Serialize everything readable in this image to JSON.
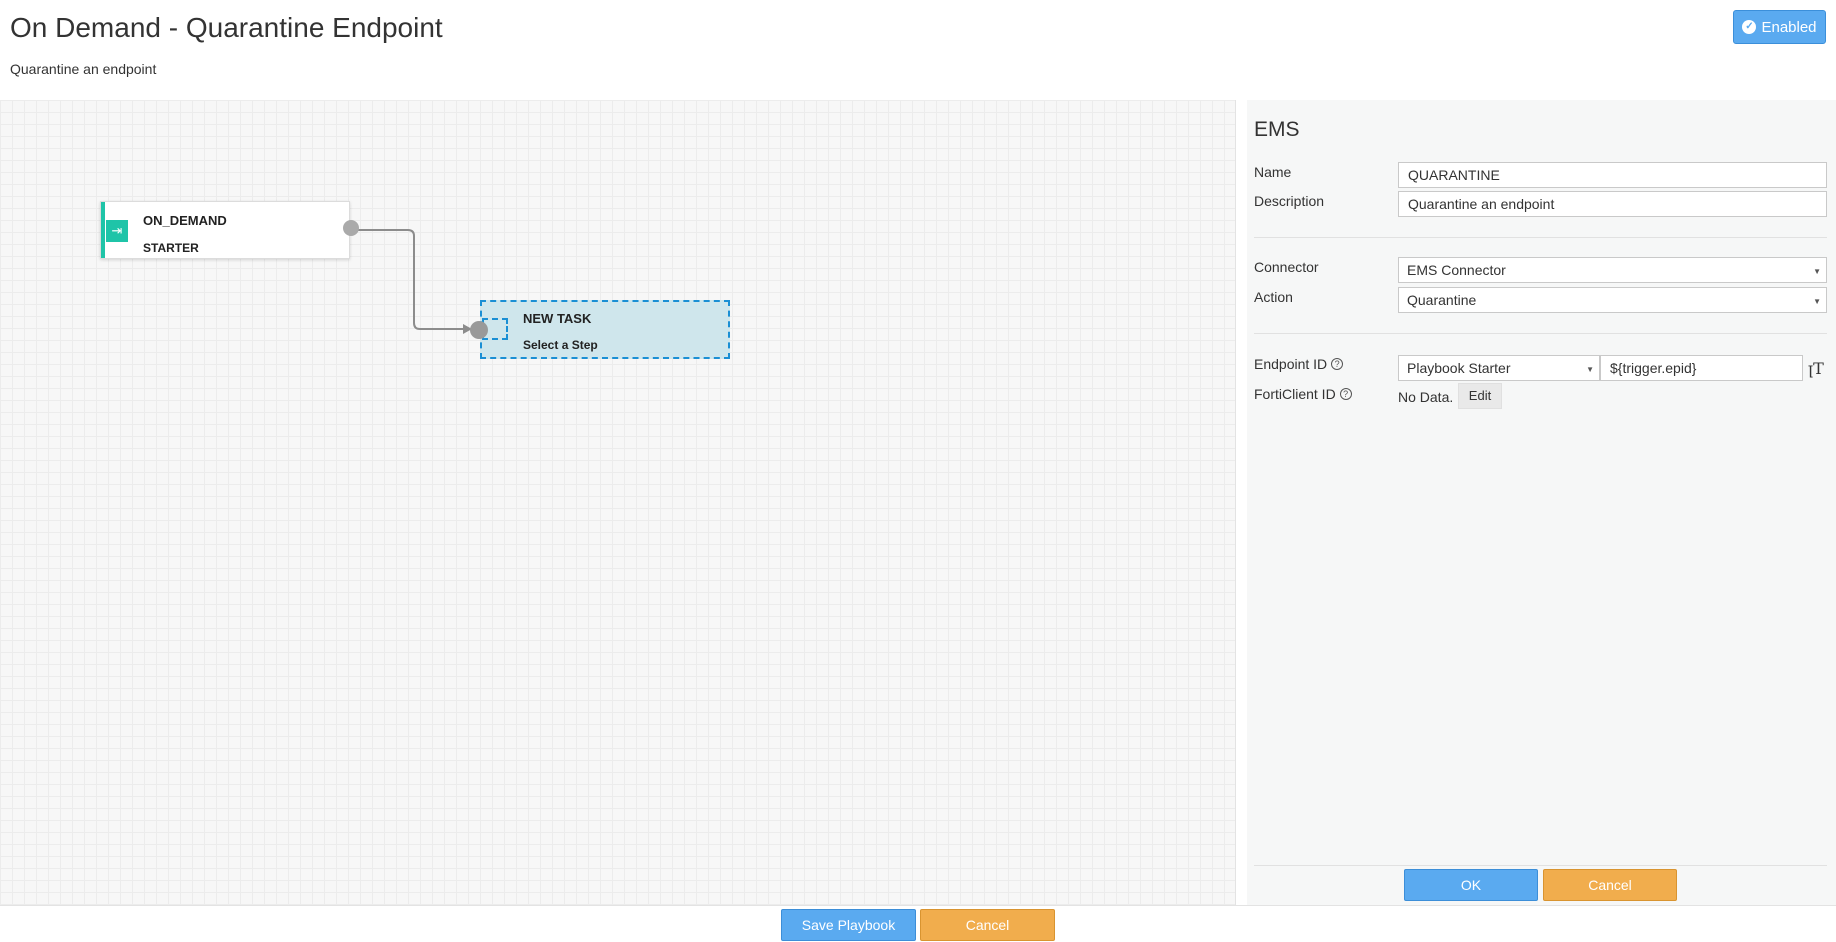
{
  "header": {
    "title": "On Demand - Quarantine Endpoint",
    "subtitle": "Quarantine an endpoint",
    "enabled_label": "Enabled"
  },
  "canvas": {
    "start_node": {
      "title": "ON_DEMAND",
      "subtitle": "STARTER",
      "icon": "login-arrow-icon"
    },
    "task_node": {
      "title": "NEW TASK",
      "subtitle": "Select a Step"
    }
  },
  "panel": {
    "title": "EMS",
    "name_label": "Name",
    "name_value": "QUARANTINE",
    "description_label": "Description",
    "description_value": "Quarantine an endpoint",
    "connector_label": "Connector",
    "connector_value": "EMS Connector",
    "action_label": "Action",
    "action_value": "Quarantine",
    "endpoint_id_label": "Endpoint ID",
    "endpoint_source_value": "Playbook Starter",
    "endpoint_expression_value": "${trigger.epid}",
    "forticlient_id_label": "FortiClient ID",
    "no_data_text": "No Data.",
    "edit_label": "Edit",
    "ok_label": "OK",
    "cancel_label": "Cancel"
  },
  "footer": {
    "save_label": "Save Playbook",
    "cancel_label": "Cancel"
  },
  "colors": {
    "accent_blue": "#5aaaf0",
    "accent_orange": "#f1ad4d",
    "starter_teal": "#1fc4a8",
    "task_border": "#1a8fd4"
  }
}
